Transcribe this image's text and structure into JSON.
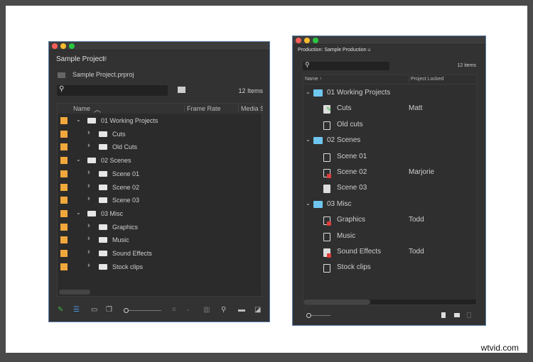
{
  "watermark": "wtvid.com",
  "left": {
    "title": "Sample Project",
    "menu_icon": "hamburger-icon",
    "file_name": "Sample Project.prproj",
    "search_placeholder": "",
    "item_count": "12 Items",
    "columns": [
      "Name",
      "Frame Rate",
      "Media S"
    ],
    "label_color": "#f0a83c",
    "rows": [
      {
        "name": "01 Working Projects",
        "level": 0,
        "expanded": true
      },
      {
        "name": "Cuts",
        "level": 1,
        "expanded": false
      },
      {
        "name": "Old Cuts",
        "level": 1,
        "expanded": false
      },
      {
        "name": "02 Scenes",
        "level": 0,
        "expanded": true
      },
      {
        "name": "Scene 01",
        "level": 1,
        "expanded": false
      },
      {
        "name": "Scene 02",
        "level": 1,
        "expanded": false
      },
      {
        "name": "Scene 03",
        "level": 1,
        "expanded": false
      },
      {
        "name": "03 Misc",
        "level": 0,
        "expanded": true
      },
      {
        "name": "Graphics",
        "level": 1,
        "expanded": false
      },
      {
        "name": "Music",
        "level": 1,
        "expanded": false
      },
      {
        "name": "Sound Effects",
        "level": 1,
        "expanded": false
      },
      {
        "name": "Stock clips",
        "level": 1,
        "expanded": false
      }
    ],
    "toolbar": [
      "pencil-icon",
      "list-view-icon",
      "icon-view-icon",
      "freeform-view-icon",
      "zoom-slider",
      "sort-icon",
      "automate-icon",
      "find-icon",
      "new-bin-icon",
      "new-item-icon"
    ]
  },
  "right": {
    "title": "Production: Sample Production",
    "menu_icon": "hamburger-icon",
    "search_placeholder": "",
    "item_count": "12 items",
    "columns": [
      "Name ↑",
      "Project Locked"
    ],
    "folder_color": "#6fc6f0",
    "lock_color": "#e03c3c",
    "rows": [
      {
        "name": "01 Working Projects",
        "type": "folder",
        "locked_by": ""
      },
      {
        "name": "Cuts",
        "type": "editing",
        "locked_by": "Matt"
      },
      {
        "name": "Old cuts",
        "type": "doc",
        "locked_by": ""
      },
      {
        "name": "02 Scenes",
        "type": "folder",
        "locked_by": ""
      },
      {
        "name": "Scene 01",
        "type": "doc",
        "locked_by": ""
      },
      {
        "name": "Scene 02",
        "type": "locked",
        "locked_by": "Marjorie"
      },
      {
        "name": "Scene 03",
        "type": "open",
        "locked_by": ""
      },
      {
        "name": "03 Misc",
        "type": "folder",
        "locked_by": ""
      },
      {
        "name": "Graphics",
        "type": "locked",
        "locked_by": "Todd"
      },
      {
        "name": "Music",
        "type": "doc",
        "locked_by": ""
      },
      {
        "name": "Sound Effects",
        "type": "locked-open",
        "locked_by": "Todd"
      },
      {
        "name": "Stock clips",
        "type": "doc",
        "locked_by": ""
      }
    ],
    "toolbar": [
      "zoom-slider",
      "new-project-icon",
      "new-folder-icon",
      "trash-icon"
    ]
  }
}
